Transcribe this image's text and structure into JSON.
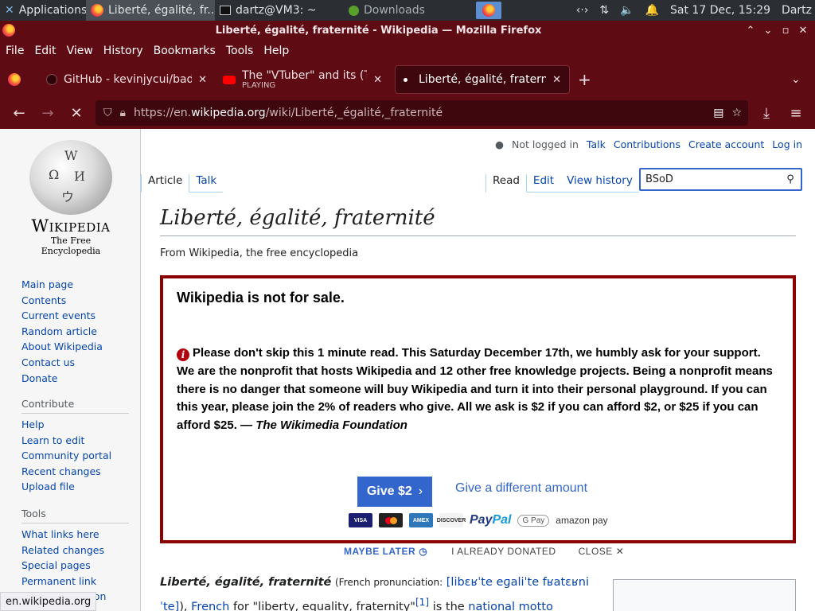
{
  "panel": {
    "apps_label": "Applications",
    "tasks": [
      "Liberté, égalité, fr...",
      "dartz@VM3: ~",
      "Downloads"
    ],
    "clock": "Sat 17 Dec, 15:29",
    "user": "Dartz"
  },
  "window": {
    "title": "Liberté, égalité, fraternité - Wikipedia — Mozilla Firefox"
  },
  "menu": [
    "File",
    "Edit",
    "View",
    "History",
    "Bookmarks",
    "Tools",
    "Help"
  ],
  "tabs": [
    {
      "label": "GitHub - kevinjycui/bad-a",
      "sub": ""
    },
    {
      "label": "The \"VTuber\" and its (Tec",
      "sub": "PLAYING"
    },
    {
      "label": "Liberté, égalité, fraternité",
      "sub": ""
    }
  ],
  "url": {
    "prefix": "https://en.",
    "host": "wikipedia.org",
    "path": "/wiki/Liberté,_égalité,_fraternité"
  },
  "wiki": {
    "wordmark": "Wikipedia",
    "tagline": "The Free Encyclopedia",
    "nav": [
      "Main page",
      "Contents",
      "Current events",
      "Random article",
      "About Wikipedia",
      "Contact us",
      "Donate"
    ],
    "contribute_head": "Contribute",
    "contribute": [
      "Help",
      "Learn to edit",
      "Community portal",
      "Recent changes",
      "Upload file"
    ],
    "tools_head": "Tools",
    "tools": [
      "What links here",
      "Related changes",
      "Special pages",
      "Permanent link",
      "Page information"
    ],
    "toplinks": {
      "not_logged": "Not logged in",
      "talk": "Talk",
      "contributions": "Contributions",
      "create": "Create account",
      "login": "Log in"
    },
    "tabs_left": [
      "Article",
      "Talk"
    ],
    "tabs_right": [
      "Read",
      "Edit",
      "View history"
    ],
    "search_value": "BSoD",
    "title": "Liberté, égalité, fraternité",
    "from": "From Wikipedia, the free encyclopedia",
    "banner": {
      "heading": "Wikipedia is not for sale.",
      "body": "Please don't skip this 1 minute read. This Saturday December 17th, we humbly ask for your support. We are the nonprofit that hosts Wikipedia and 12 other free knowledge projects. Being a nonprofit means there is no danger that someone will buy Wikipedia and turn it into their personal playground. If you can this year, please join the 2% of readers who give. All we ask is $2 if you can afford $2, or $25 if you can afford $25. —",
      "signature": "The Wikimedia Foundation",
      "give_btn": "Give $2",
      "diff_amount": "Give a different amount",
      "maybe_later": "MAYBE LATER",
      "already": "I ALREADY DONATED",
      "close": "CLOSE"
    },
    "article_start": "Liberté, égalité, fraternité",
    "article_pron": "(French pronunciation:",
    "ipa": "[libɛʁˈte eɡaliˈte fʁatɛʁniˈte]",
    "article_rest_1": "),",
    "link_french": "French",
    "for": "for",
    "quote": "\"liberty, equality, fraternity\"",
    "ref": "[1]",
    "is_the": "is the",
    "link_motto": "national motto"
  },
  "status_url": "en.wikipedia.org"
}
